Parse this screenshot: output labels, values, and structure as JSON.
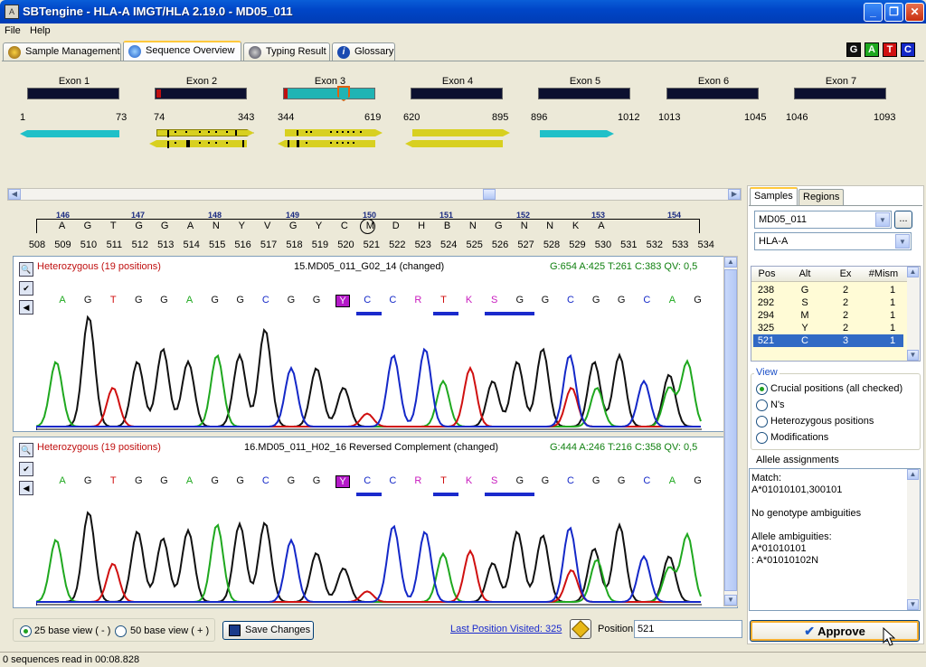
{
  "window": {
    "title": "SBTengine - HLA-A IMGT/HLA 2.19.0 - MD05_011",
    "app_icon_label": "A"
  },
  "menu": [
    "File",
    "Help"
  ],
  "tabs": [
    {
      "label": "Sample Management",
      "active": false
    },
    {
      "label": "Sequence Overview",
      "active": true
    },
    {
      "label": "Typing Result",
      "active": false
    },
    {
      "label": "Glossary",
      "active": false
    }
  ],
  "gatc": [
    {
      "label": "G",
      "color": "#111111"
    },
    {
      "label": "A",
      "color": "#1fa81f"
    },
    {
      "label": "T",
      "color": "#d01010"
    },
    {
      "label": "C",
      "color": "#1428c8"
    }
  ],
  "exons": [
    {
      "label": "Exon 1",
      "start": "1",
      "end": "73"
    },
    {
      "label": "Exon 2",
      "start": "74",
      "end": "343"
    },
    {
      "label": "Exon 3",
      "start": "344",
      "end": "619"
    },
    {
      "label": "Exon 4",
      "start": "620",
      "end": "895"
    },
    {
      "label": "Exon 5",
      "start": "896",
      "end": "1012"
    },
    {
      "label": "Exon 6",
      "start": "1013",
      "end": "1045"
    },
    {
      "label": "Exon 7",
      "start": "1046",
      "end": "1093"
    }
  ],
  "ruler": {
    "codons": [
      "146",
      "147",
      "148",
      "149",
      "150",
      "151",
      "152",
      "153",
      "154"
    ],
    "bases": [
      "A",
      "G",
      "T",
      "G",
      "G",
      "A",
      "N",
      "Y",
      "V",
      "G",
      "Y",
      "C",
      "M",
      "D",
      "H",
      "B",
      "N",
      "G",
      "N",
      "N",
      "K",
      "A"
    ],
    "positions": [
      "508",
      "509",
      "510",
      "511",
      "512",
      "513",
      "514",
      "515",
      "516",
      "517",
      "518",
      "519",
      "520",
      "521",
      "522",
      "523",
      "524",
      "525",
      "526",
      "527",
      "528",
      "529",
      "530",
      "531",
      "532",
      "533",
      "534"
    ]
  },
  "traces": [
    {
      "zygosity": "Heterozygous (19 positions)",
      "name": "15.MD05_011_G02_14 (changed)",
      "stats": "G:654 A:425 T:261 C:383 QV: 0,5",
      "bases": [
        "A",
        "G",
        "T",
        "G",
        "G",
        "A",
        "G",
        "G",
        "C",
        "G",
        "G",
        "Y",
        "C",
        "C",
        "R",
        "T",
        "K",
        "S",
        "G",
        "G",
        "C",
        "G",
        "G",
        "C",
        "A",
        "G"
      ]
    },
    {
      "zygosity": "Heterozygous (19 positions)",
      "name": "16.MD05_011_H02_16 Reversed Complement (changed)",
      "stats": "G:444 A:246 T:216 C:358 QV: 0,5",
      "bases": [
        "A",
        "G",
        "T",
        "G",
        "G",
        "A",
        "G",
        "G",
        "C",
        "G",
        "G",
        "Y",
        "C",
        "C",
        "R",
        "T",
        "K",
        "S",
        "G",
        "G",
        "C",
        "G",
        "G",
        "C",
        "A",
        "G"
      ]
    }
  ],
  "side_tabs": [
    "Samples",
    "Regions"
  ],
  "sample_combo": "MD05_011",
  "browse_label": "...",
  "region_combo": "HLA-A",
  "positions_table": {
    "headers": [
      "Pos",
      "Alt",
      "Ex",
      "#Mism"
    ],
    "rows": [
      [
        "238",
        "G",
        "2",
        "1"
      ],
      [
        "292",
        "S",
        "2",
        "1"
      ],
      [
        "294",
        "M",
        "2",
        "1"
      ],
      [
        "325",
        "Y",
        "2",
        "1"
      ],
      [
        "521",
        "C",
        "3",
        "1"
      ]
    ],
    "selected_index": 4
  },
  "view": {
    "title": "View",
    "options": [
      "Crucial positions (all checked)",
      "N's",
      "Heterozygous positions",
      "Modifications"
    ],
    "selected": 0
  },
  "allele": {
    "title": "Allele assignments",
    "lines": [
      "Match:",
      "A*01010101,300101",
      "",
      "No genotype ambiguities",
      "",
      "Allele ambiguities:",
      "A*01010101",
      ":  A*01010102N"
    ]
  },
  "approve_label": "Approve",
  "bottom": {
    "view25": "25 base view ( - )",
    "view50": "50 base view ( + )",
    "save": "Save Changes",
    "last_visited": "Last Position Visited: 325",
    "position_label": "Position",
    "position_value": "521"
  },
  "status": "0 sequences read in 00:08.828"
}
